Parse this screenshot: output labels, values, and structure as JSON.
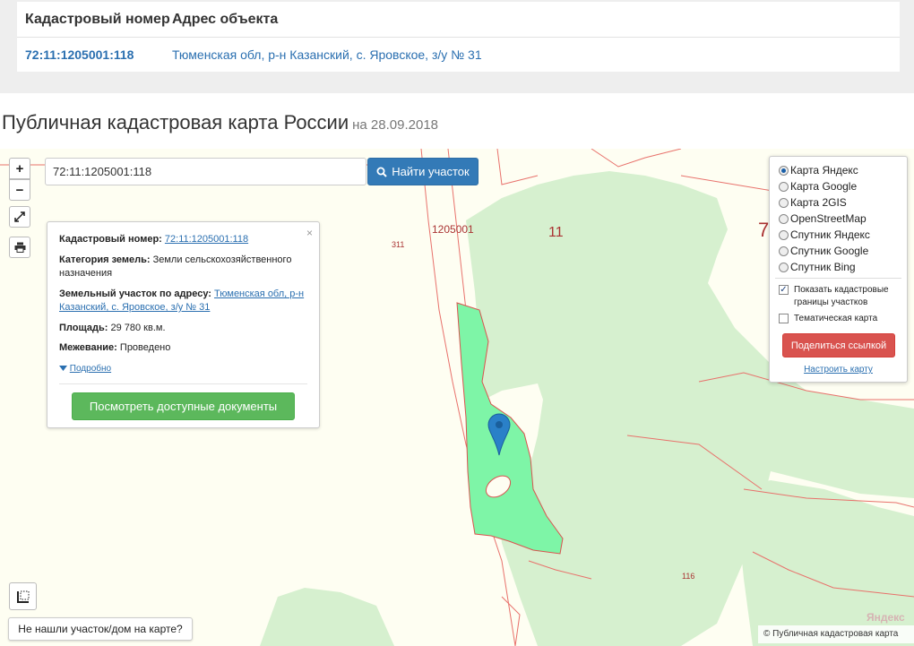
{
  "table": {
    "headers": [
      "Кадастровый номер",
      "Адрес объекта"
    ],
    "rows": [
      [
        "72:11:1205001:118",
        "Тюменская обл, р-н Казанский, с. Яровское, з/у № 31"
      ]
    ]
  },
  "page": {
    "title": "Публичная кадастровая карта России",
    "date": "на 28.09.2018"
  },
  "map": {
    "search": {
      "value": "72:11:1205001:118",
      "button_label": "Найти участок"
    },
    "controls": {
      "zoom_in": "+",
      "zoom_out": "−"
    },
    "labels": {
      "quarter": "1205001",
      "district": "11",
      "region": "7",
      "parcel_311": "311",
      "parcel_116": "116"
    },
    "info": {
      "cad_label": "Кадастровый номер:",
      "cad_value": "72:11:1205001:118",
      "category_label": "Категория земель:",
      "category_value": "Земли сельскохозяйственного назначения",
      "address_label": "Земельный участок по адресу:",
      "address_value": "Тюменская обл, р-н Казанский, с. Яровское, з/у № 31",
      "area_label": "Площадь:",
      "area_value": "29 780 кв.м.",
      "survey_label": "Межевание:",
      "survey_value": "Проведено",
      "more": "Подробно",
      "docs_button": "Посмотреть доступные документы",
      "close": "×"
    },
    "layers": {
      "options": [
        "Карта Яндекс",
        "Карта Google",
        "Карта 2GIS",
        "OpenStreetMap",
        "Спутник Яндекс",
        "Спутник Google",
        "Спутник Bing"
      ],
      "selected": "Карта Яндекс",
      "show_borders": "Показать кадастровые границы участков",
      "show_borders_checked": true,
      "thematic": "Тематическая карта",
      "thematic_checked": false,
      "share_button": "Поделиться ссылкой",
      "configure_link": "Настроить карту"
    },
    "not_found": "Не нашли участок/дом на карте?",
    "copyright": "© Публичная кадастровая карта",
    "provider_logo": "Яндекс"
  },
  "colors": {
    "primary": "#337ab7",
    "success": "#5cb85c",
    "danger": "#d9534f",
    "parcel": "#7ef5a7",
    "forest": "#d6f0cf",
    "boundary": "#e8716b"
  }
}
